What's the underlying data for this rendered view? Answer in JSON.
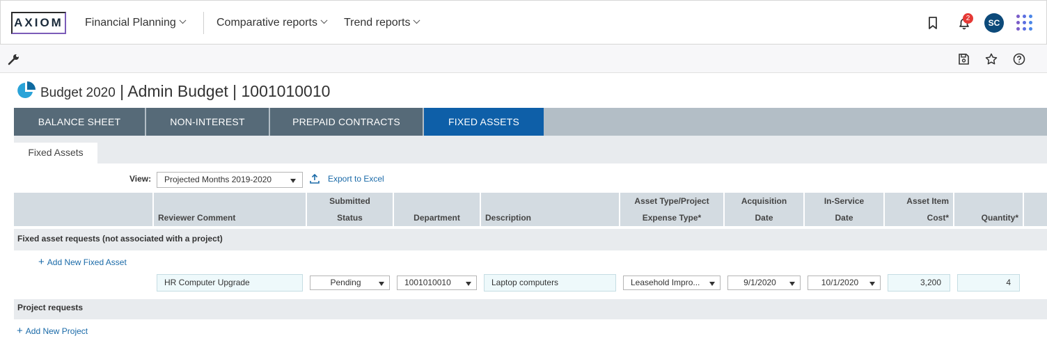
{
  "app": {
    "logo": "AXIOM",
    "nav": [
      "Financial Planning",
      "Comparative reports",
      "Trend reports"
    ],
    "notifications_count": "2",
    "user_initials": "SC"
  },
  "page": {
    "title_main": "Budget 2020",
    "title_rest": "Admin Budget | 1001010010"
  },
  "tabs": [
    "BALANCE SHEET",
    "NON-INTEREST",
    "PREPAID CONTRACTS",
    "FIXED ASSETS"
  ],
  "active_tab": "FIXED ASSETS",
  "subtab": "Fixed Assets",
  "view": {
    "label": "View:",
    "selected": "Projected Months 2019-2020",
    "export_label": "Export to Excel"
  },
  "columns": [
    {
      "l1": "",
      "l2": "Reviewer Comment"
    },
    {
      "l1": "Submitted",
      "l2": "Status"
    },
    {
      "l1": "",
      "l2": "Department"
    },
    {
      "l1": "",
      "l2": "Description"
    },
    {
      "l1": "Asset Type/Project",
      "l2": "Expense Type*"
    },
    {
      "l1": "Acquisition",
      "l2": "Date"
    },
    {
      "l1": "In-Service",
      "l2": "Date"
    },
    {
      "l1": "Asset Item",
      "l2": "Cost*"
    },
    {
      "l1": "",
      "l2": "Quantity*"
    }
  ],
  "sections": {
    "fixed_requests": "Fixed asset requests (not associated with a project)",
    "add_fixed_asset": "Add New Fixed Asset",
    "project_requests": "Project requests",
    "add_project": "Add New Project"
  },
  "row": {
    "reviewer_comment": "HR Computer Upgrade",
    "status": "Pending",
    "department": "1001010010",
    "description": "Laptop computers",
    "asset_type": "Leasehold Impro...",
    "acquisition_date": "9/1/2020",
    "in_service_date": "10/1/2020",
    "cost": "3,200",
    "quantity": "4"
  },
  "colors": {
    "tab": "#566a78",
    "tab_active": "#0e5fa8",
    "link": "#1a6aa8",
    "badge": "#e53935",
    "avatar": "#0d4a7a"
  }
}
